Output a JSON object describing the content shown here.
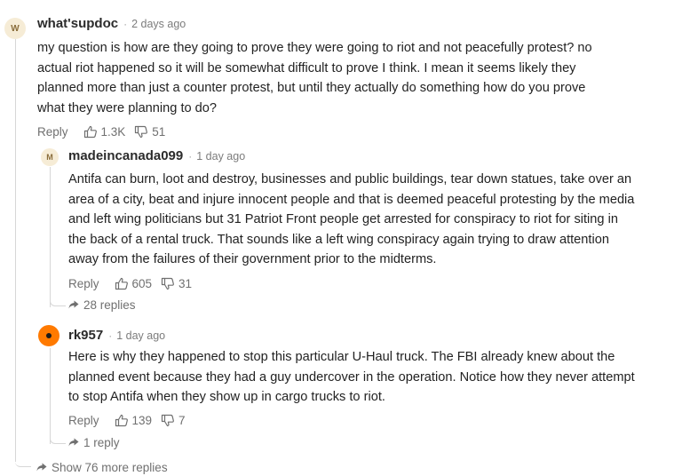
{
  "comments": [
    {
      "avatar_letter": "W",
      "username": "what'supdoc",
      "separator": "·",
      "age": "2 days ago",
      "lines": [
        "my question is how are they going to prove they were going to riot and not peacefully protest?  no",
        "actual riot happened so it will be somewhat difficult to prove I think. I mean it seems likely they",
        "planned more than just a counter protest, but until they actually do something how do you prove",
        "what they were planning to do?"
      ],
      "reply_label": "Reply",
      "upvotes": "1.3K",
      "downvotes": "51"
    },
    {
      "avatar_letter": "M",
      "username": "madeincanada099",
      "separator": "·",
      "age": "1 day ago",
      "lines": [
        "Antifa can burn, loot and destroy, businesses and public buildings, tear down statues, take over an",
        "area of a city, beat and injure innocent people and that is deemed peaceful protesting by the media",
        "and left wing politicians but 31 Patriot Front people get arrested for conspiracy to riot for siting in",
        "the back of a rental truck. That sounds like a left wing conspiracy again trying to draw attention",
        "away from the failures of their government prior to the midterms."
      ],
      "reply_label": "Reply",
      "upvotes": "605",
      "downvotes": "31",
      "replies_link": "28 replies"
    },
    {
      "avatar_letter": "",
      "username": "rk957",
      "separator": "·",
      "age": "1 day ago",
      "lines": [
        "Here is why they happened to stop this particular U-Haul truck. The FBI already knew about the",
        "planned event because they had a guy undercover in the operation. Notice how they never attempt",
        "to stop Antifa when they show up in cargo trucks to riot."
      ],
      "reply_label": "Reply",
      "upvotes": "139",
      "downvotes": "7",
      "replies_link": "1 reply"
    }
  ],
  "show_more": "Show 76 more replies",
  "colors": {
    "text": "#222222",
    "muted": "#707070",
    "thread_line": "#d7d7d7",
    "avatar_orange": "#ff7a00",
    "avatar_letter_bg": "#f6ecd6"
  },
  "icons": [
    "thumbs-up-icon",
    "thumbs-down-icon",
    "reply-arrow-icon"
  ]
}
